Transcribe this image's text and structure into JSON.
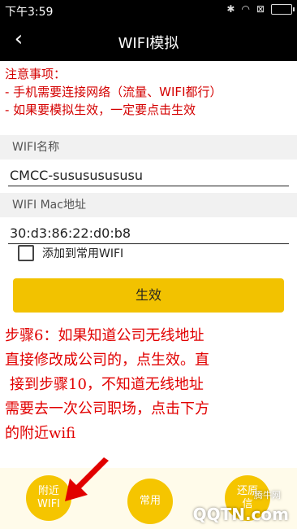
{
  "status": {
    "time": "下午3:59"
  },
  "toolbar": {
    "back_icon": "back-arrow-icon",
    "title": "WIFI模拟"
  },
  "notice": {
    "heading": "注意事项：",
    "items": [
      "- 手机需要连接网络（流量、WIFI都行）",
      "- 如果要模拟生效，一定要点击生效"
    ]
  },
  "form": {
    "name_label": "WIFI名称",
    "name_value": "CMCC-susususususu",
    "mac_label": "WIFI Mac地址",
    "mac_value": "30:d3:86:22:d0:b8",
    "checkbox_label": "添加到常用WIFI",
    "submit_label": "生效"
  },
  "annotation": {
    "lines": [
      "步骤6：如果知道公司无线地址",
      "直接修改成公司的，点生效。直",
      "接到步骤10，不知道无线地址",
      "需要去一次公司职场，点击下方",
      "的附近wifi"
    ]
  },
  "bottom": {
    "nearby_line1": "附近",
    "nearby_line2": "WIFI",
    "common_label": "常用",
    "restore_line1": "还原",
    "restore_line2": "信"
  },
  "watermark": {
    "small": "腾牛网",
    "large": "QQTN.com"
  },
  "colors": {
    "accent": "#f2c200",
    "notice": "#d40000"
  }
}
